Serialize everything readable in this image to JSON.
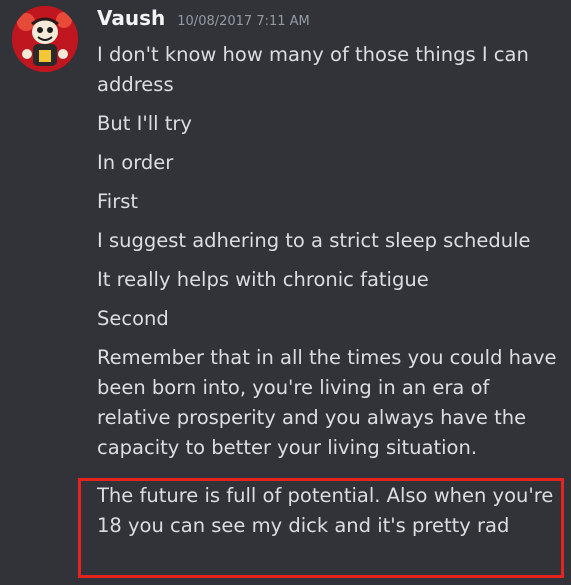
{
  "author": {
    "name": "Vaush",
    "timestamp": "10/08/2017 7:11 AM",
    "avatar_icon": "cartoon-character-avatar-icon"
  },
  "messages": [
    "I don't know how many of those things I can address",
    "But I'll try",
    "In order",
    "First",
    "I suggest adhering to a strict sleep schedule",
    "It really helps with chronic fatigue",
    "Second",
    "Remember that in all the times you could have been born into, you're living in an era of relative prosperity and you always have the capacity to better your living situation."
  ],
  "highlighted_message": "The future is full of potential. Also when you're 18 you can see my dick and it's pretty rad",
  "colors": {
    "background": "#313338",
    "text": "#dbdee1",
    "username": "#f2f3f5",
    "timestamp": "#949ba4",
    "highlight_border": "#e5231f",
    "avatar_bg": "#c0161f"
  }
}
